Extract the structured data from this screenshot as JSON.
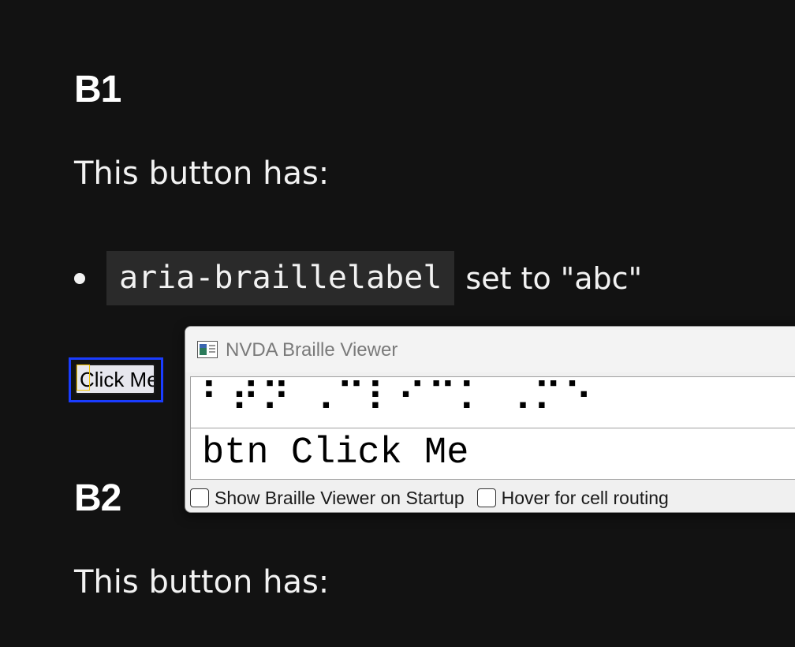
{
  "section1": {
    "heading": "B1",
    "intro": "This button has:",
    "bullet_code": "aria-braillelabel",
    "bullet_text": "set to \"abc\"",
    "button_label": "Click Me"
  },
  "section2": {
    "heading": "B2",
    "intro": "This button has:"
  },
  "braille_viewer": {
    "title": "NVDA Braille Viewer",
    "braille_output": "⠃⠞⠝ ⠠⠉⠇⠊⠉⠅ ⠠⠍⠑",
    "text_output": "btn Click Me",
    "show_on_startup_label": "Show Braille Viewer on Startup",
    "hover_routing_label": "Hover for cell routing",
    "show_on_startup_checked": false,
    "hover_routing_checked": false
  },
  "colors": {
    "page_background": "#121212",
    "focus_outline": "#1a3cff",
    "caret_highlight": "#f5c400"
  }
}
